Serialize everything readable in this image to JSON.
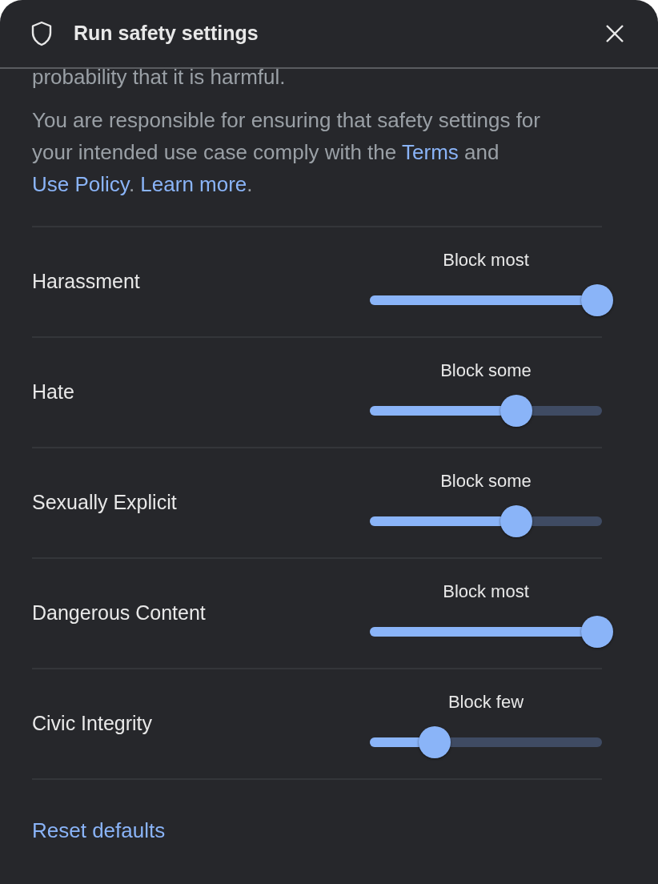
{
  "dialog": {
    "title": "Run safety settings"
  },
  "intro_tail": "probability that it is harmful.",
  "notice": "You are responsible for ensuring that safety settings for your intended use case comply with the",
  "links": [
    {
      "text": "Terms"
    },
    {
      "text": "Use Policy",
      "before": " and "
    },
    {
      "text": "Learn more",
      "before": ". "
    }
  ],
  "notice_end": ".",
  "categories": [
    {
      "name": "Harassment",
      "reading": "Block most",
      "level": 1
    },
    {
      "name": "Hate",
      "reading": "Block some",
      "level": 0.667
    },
    {
      "name": "Sexually Explicit",
      "reading": "Block some",
      "level": 0.667
    },
    {
      "name": "Dangerous Content",
      "reading": "Block most",
      "level": 1
    },
    {
      "name": "Civic Integrity",
      "reading": "Block few",
      "level": 0.333
    }
  ],
  "reset_button": "Reset defaults"
}
